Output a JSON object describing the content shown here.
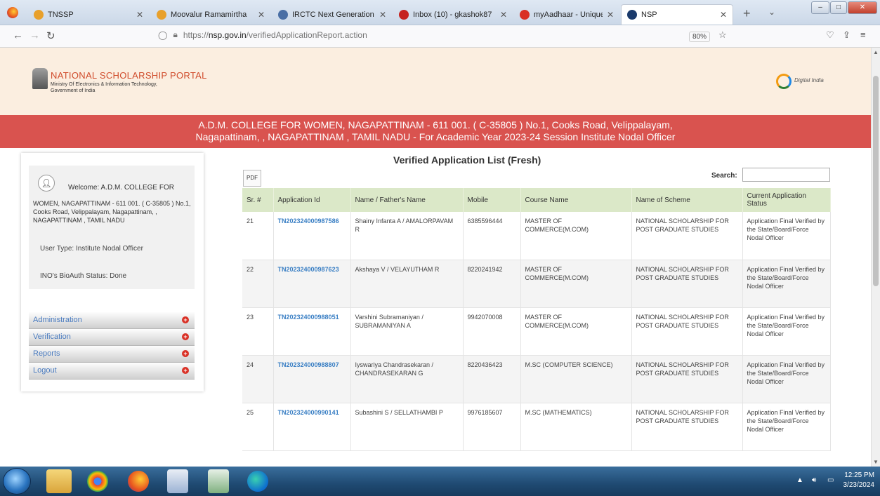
{
  "browser": {
    "tabs": [
      {
        "label": "TNSSP",
        "color": "#e8a02b",
        "active": false
      },
      {
        "label": "Moovalur Ramamirtha",
        "color": "#e8a02b",
        "active": false
      },
      {
        "label": "IRCTC Next Generation",
        "color": "#4a6fa5",
        "active": false
      },
      {
        "label": "Inbox (10) - gkashok87",
        "color": "#c5221f",
        "active": false
      },
      {
        "label": "myAadhaar - Unique Id",
        "color": "#d93025",
        "active": false
      },
      {
        "label": "NSP",
        "color": "#1a3a6b",
        "active": true
      }
    ],
    "url_prefix": "https://",
    "url_host": "nsp.gov.in",
    "url_path": "/verifiedApplicationReport.action",
    "zoom": "80%"
  },
  "header": {
    "portal_name": "NATIONAL SCHOLARSHIP PORTAL",
    "portal_sub1": "Ministry Of Electronics & Information Technology,",
    "portal_sub2": "Government of India",
    "digital_india": "Digital India"
  },
  "banner": {
    "line1": "A.D.M. COLLEGE FOR WOMEN, NAGAPATTINAM - 611 001. ( C-35805 ) No.1, Cooks Road, Velippalayam,",
    "line2": "Nagapattinam, , NAGAPATTINAM , TAMIL NADU - For Academic Year 2023-24 Session   Institute Nodal Officer"
  },
  "sidebar": {
    "welcome_label": "Welcome: A.D.M. COLLEGE FOR",
    "welcome_rest": "WOMEN, NAGAPATTINAM - 611 001. ( C-35805 ) No.1, Cooks Road, Velippalayam, Nagapattinam, , NAGAPATTINAM , TAMIL NADU",
    "user_type": "User Type:   Institute Nodal Officer",
    "bio_status": "INO's BioAuth Status:   Done",
    "menu": [
      "Administration",
      "Verification",
      "Reports",
      "Logout"
    ]
  },
  "main": {
    "title": "Verified Application List (Fresh)",
    "pdf_label": "PDF",
    "search_label": "Search:",
    "search_value": "",
    "columns": [
      "Sr. #",
      "Application Id",
      "Name / Father's Name",
      "Mobile",
      "Course Name",
      "Name of Scheme",
      "Current Application Status"
    ],
    "rows": [
      {
        "sr": "21",
        "app_id": "TN202324000987586",
        "name": "Shainy Infanta A / AMALORPAVAM R",
        "mobile": "6385596444",
        "course": "MASTER OF COMMERCE(M.COM)",
        "scheme": "NATIONAL SCHOLARSHIP FOR POST GRADUATE STUDIES",
        "status": "Application Final Verified by the State/Board/Force Nodal Officer"
      },
      {
        "sr": "22",
        "app_id": "TN202324000987623",
        "name": "Akshaya V / VELAYUTHAM R",
        "mobile": "8220241942",
        "course": "MASTER OF COMMERCE(M.COM)",
        "scheme": "NATIONAL SCHOLARSHIP FOR POST GRADUATE STUDIES",
        "status": "Application Final Verified by the State/Board/Force Nodal Officer"
      },
      {
        "sr": "23",
        "app_id": "TN202324000988051",
        "name": "Varshini Subramaniyan / SUBRAMANIYAN A",
        "mobile": "9942070008",
        "course": "MASTER OF COMMERCE(M.COM)",
        "scheme": "NATIONAL SCHOLARSHIP FOR POST GRADUATE STUDIES",
        "status": "Application Final Verified by the State/Board/Force Nodal Officer"
      },
      {
        "sr": "24",
        "app_id": "TN202324000988807",
        "name": "Iyswariya Chandrasekaran / CHANDRASEKARAN G",
        "mobile": "8220436423",
        "course": "M.SC (COMPUTER SCIENCE)",
        "scheme": "NATIONAL SCHOLARSHIP FOR POST GRADUATE STUDIES",
        "status": "Application Final Verified by the State/Board/Force Nodal Officer"
      },
      {
        "sr": "25",
        "app_id": "TN202324000990141",
        "name": "Subashini S / SELLATHAMBI P",
        "mobile": "9976185607",
        "course": "M.SC (MATHEMATICS)",
        "scheme": "NATIONAL SCHOLARSHIP FOR POST GRADUATE STUDIES",
        "status": "Application Final Verified by the State/Board/Force Nodal Officer"
      }
    ]
  },
  "taskbar": {
    "time": "12:25 PM",
    "date": "3/23/2024"
  }
}
